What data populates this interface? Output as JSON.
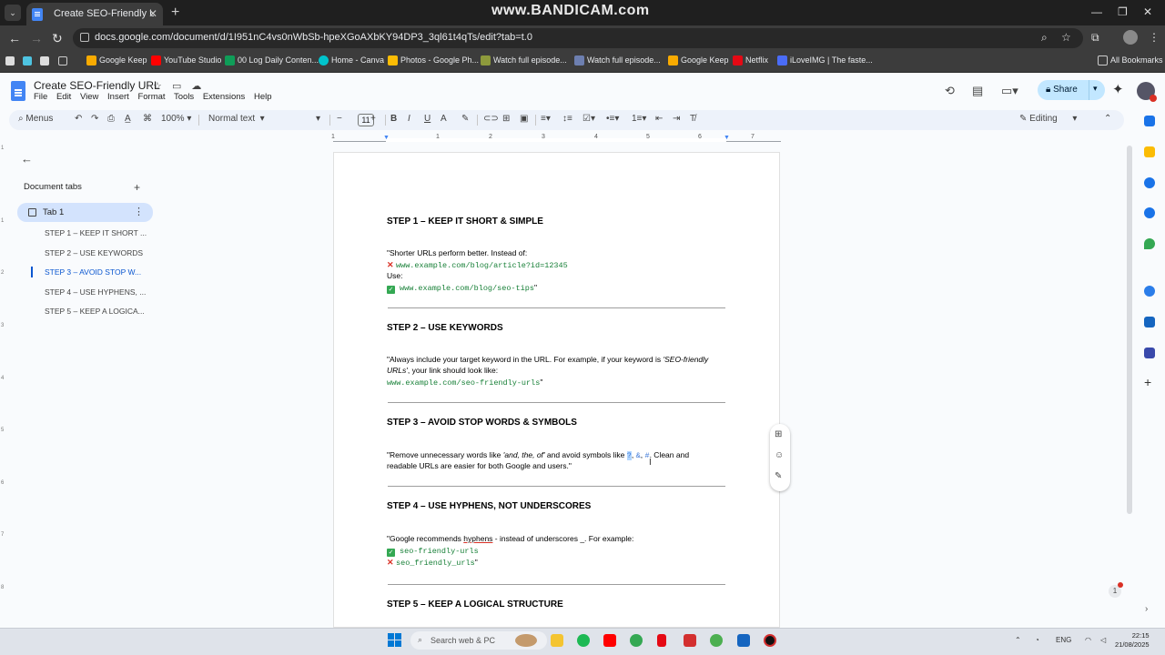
{
  "browser": {
    "tab_title": "Create SEO-Friendly URL - Goo",
    "watermark": "www.BANDICAM.com",
    "url": "docs.google.com/document/d/1I951nC4vs0nWbSb-hpeXGoAXbKY94DP3_3ql61t4qTs/edit?tab=t.0",
    "bookmarks": [
      {
        "label": "Google Keep",
        "color": "#f9ab00"
      },
      {
        "label": "YouTube Studio",
        "color": "#ff0000"
      },
      {
        "label": "00 Log Daily Conten...",
        "color": "#0f9d58"
      },
      {
        "label": "Home - Canva",
        "color": "#00c4cc"
      },
      {
        "label": "Photos - Google Ph...",
        "color": "#fbbc04"
      },
      {
        "label": "Watch full episode...",
        "color": "#8e9a3c"
      },
      {
        "label": "Watch full episode...",
        "color": "#6d7fb0"
      },
      {
        "label": "Google Keep",
        "color": "#f9ab00"
      },
      {
        "label": "Netflix",
        "color": "#e50914"
      },
      {
        "label": "iLoveIMG | The faste...",
        "color": "#4a6cf7"
      }
    ],
    "all_bookmarks": "All Bookmarks"
  },
  "docs": {
    "title": "Create SEO-Friendly URL",
    "menu": [
      "File",
      "Edit",
      "View",
      "Insert",
      "Format",
      "Tools",
      "Extensions",
      "Help"
    ],
    "share": "Share",
    "toolbar": {
      "menus": "Menus",
      "zoom": "100%",
      "style": "Normal text",
      "font_size": "11",
      "mode": "Editing"
    }
  },
  "sidebar": {
    "heading": "Document tabs",
    "tab_label": "Tab 1",
    "items": [
      "STEP 1 – KEEP IT SHORT ...",
      "STEP 2 – USE KEYWORDS",
      "STEP 3 – AVOID STOP W...",
      "STEP 4 – USE HYPHENS, ...",
      "STEP 5 – KEEP A LOGICA..."
    ]
  },
  "document": {
    "s1": {
      "heading": "STEP 1 – KEEP IT SHORT & SIMPLE",
      "intro": "\"Shorter URLs perform better. Instead of:",
      "bad_url": "www.example.com/blog/article?id=12345",
      "use": "Use:",
      "good_url": "www.example.com/blog/seo-tips",
      "end_quote": "\""
    },
    "s2": {
      "heading": "STEP 2 – USE KEYWORDS",
      "line1_a": "\"Always include your target keyword in the URL. For example, if your keyword is ",
      "line1_b": "'SEO-friendly",
      "line2_a": "URLs'",
      "line2_b": ", your link should look like:",
      "url": "www.example.com/seo-friendly-urls",
      "end_quote": "\""
    },
    "s3": {
      "heading": "STEP 3 – AVOID STOP WORDS & SYMBOLS",
      "line1_a": "\"Remove unnecessary words like ",
      "line1_b": "'and, the, of'",
      "line1_c": " and avoid symbols like ",
      "sym1": "?",
      "sym2": "&",
      "sym3": "#",
      "line1_d": ". Clean and",
      "line2": "readable URLs are easier for both Google and users.\""
    },
    "s4": {
      "heading": "STEP 4 – USE HYPHENS, NOT UNDERSCORES",
      "line1_a": "\"Google recommends ",
      "line1_b": "hyphens",
      "line1_c": " - instead of underscores _. For example:",
      "good": "seo-friendly-urls",
      "bad": "seo_friendly_urls",
      "end_quote": "\""
    },
    "s5": {
      "heading": "STEP 5 – KEEP A LOGICAL STRUCTURE"
    }
  },
  "ruler": [
    "1",
    "1",
    "2",
    "3",
    "4",
    "5",
    "6",
    "7"
  ],
  "notification_count": "1",
  "taskbar": {
    "search": "Search web & PC",
    "lang": "ENG",
    "time": "22:15",
    "date": "21/08/2025"
  }
}
